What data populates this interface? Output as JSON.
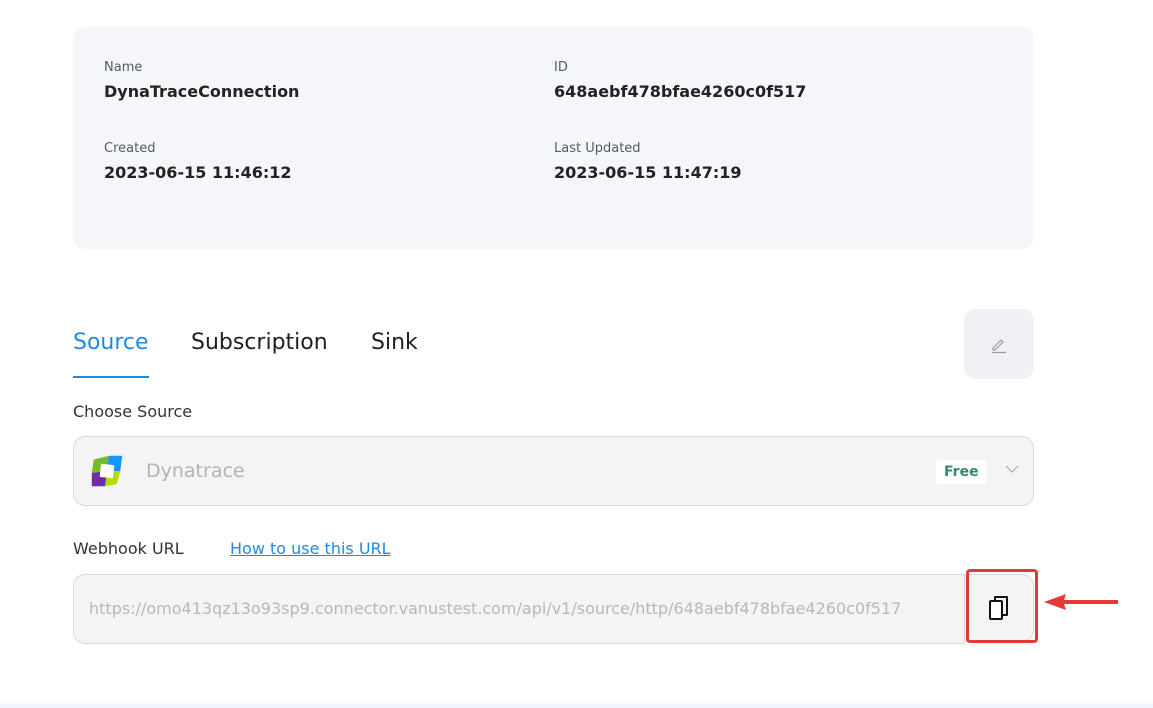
{
  "info": {
    "name_label": "Name",
    "name_value": "DynaTraceConnection",
    "id_label": "ID",
    "id_value": "648aebf478bfae4260c0f517",
    "created_label": "Created",
    "created_value": "2023-06-15 11:46:12",
    "updated_label": "Last Updated",
    "updated_value": "2023-06-15 11:47:19"
  },
  "tabs": [
    {
      "label": "Source",
      "active": true
    },
    {
      "label": "Subscription",
      "active": false
    },
    {
      "label": "Sink",
      "active": false
    }
  ],
  "source": {
    "section_label": "Choose Source",
    "selected": "Dynatrace",
    "badge": "Free",
    "logo_colors": [
      "#73be28",
      "#1496ff",
      "#6f2da8",
      "#b4dc00"
    ]
  },
  "webhook": {
    "label": "Webhook URL",
    "help_link": "How to use this URL",
    "url": "https://omo413qz13o93sp9.connector.vanustest.com/api/v1/source/http/648aebf478bfae4260c0f517"
  },
  "icons": {
    "edit": "pencil-icon",
    "chevron": "chevron-down-icon",
    "copy": "copy-icon",
    "annotation": "arrow-left-icon"
  },
  "colors": {
    "accent": "#1f8ae5",
    "highlight": "#e53935",
    "badge_text": "#2f8a6f"
  }
}
